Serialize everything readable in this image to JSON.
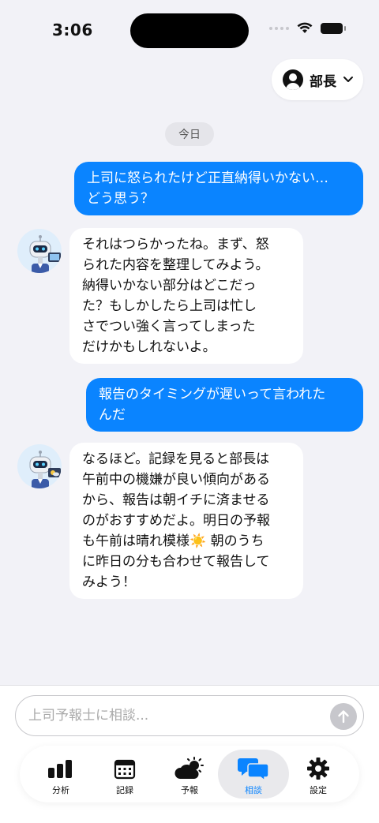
{
  "status_bar": {
    "time": "3:06"
  },
  "header": {
    "role_label": "部長",
    "role_chevron": "﹀"
  },
  "chat": {
    "date_label": "今日",
    "messages": [
      {
        "sender": "user",
        "lines": [
          "上司に怒られたけど正直納得いかない…",
          "どう思う？"
        ]
      },
      {
        "sender": "bot",
        "lines": [
          "それはつらかったね。まず、怒",
          "られた内容を整理してみよう。",
          "納得いかない部分はどこだっ",
          "た？もしかしたら上司は忙し",
          "さでつい強く言ってしまった",
          "だけかもしれないよ。"
        ]
      },
      {
        "sender": "user",
        "lines": [
          "報告のタイミングが遅いって言われた",
          "んだ"
        ]
      },
      {
        "sender": "bot",
        "lines": [
          "なるほど。記録を見ると部長は",
          "午前中の機嫌が良い傾向がある",
          "から、報告は朝イチに済ませる",
          "のがおすすめだよ。明日の予報",
          "も午前は晴れ模様☀️ 朝のうち",
          "に昨日の分も合わせて報告して",
          "みよう！"
        ]
      }
    ]
  },
  "input": {
    "placeholder": "上司予報士に相談..."
  },
  "tabs": [
    {
      "label": "分析",
      "icon": "bar-chart-icon"
    },
    {
      "label": "記録",
      "icon": "calendar-icon"
    },
    {
      "label": "予報",
      "icon": "partly-cloudy-icon"
    },
    {
      "label": "相談",
      "icon": "chat-bubbles-icon",
      "active": true
    },
    {
      "label": "設定",
      "icon": "gear-icon"
    }
  ],
  "colors": {
    "accent": "#0a84ff",
    "user_bubble": "#0a84ff",
    "bot_bubble": "#ffffff",
    "background": "#f2f2f7"
  }
}
